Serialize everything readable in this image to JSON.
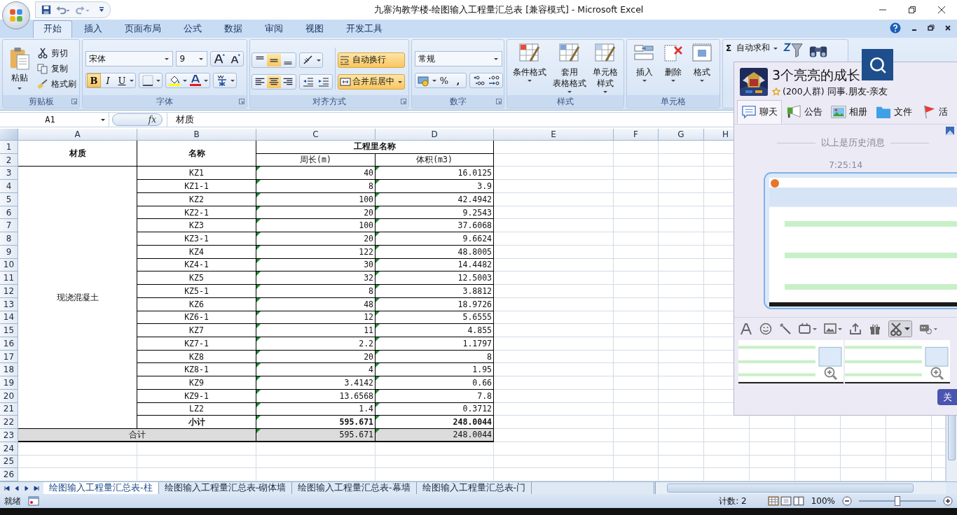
{
  "window": {
    "title": "九寨沟教学楼-绘图输入工程量汇总表  [兼容模式] - Microsoft Excel"
  },
  "ribbon_tabs": [
    {
      "label": "开始",
      "selected": true
    },
    {
      "label": "插入",
      "selected": false
    },
    {
      "label": "页面布局",
      "selected": false
    },
    {
      "label": "公式",
      "selected": false
    },
    {
      "label": "数据",
      "selected": false
    },
    {
      "label": "审阅",
      "selected": false
    },
    {
      "label": "视图",
      "selected": false
    },
    {
      "label": "开发工具",
      "selected": false
    }
  ],
  "ribbon": {
    "clipboard": {
      "label": "剪贴板",
      "paste": "粘贴",
      "cut": "剪切",
      "copy": "复制",
      "painter": "格式刷"
    },
    "font": {
      "label": "字体",
      "name": "宋体",
      "size": "9",
      "bold": {
        "text": "B",
        "selected": true
      },
      "italic": {
        "text": "I",
        "selected": false
      },
      "underline": {
        "text": "U",
        "selected": false
      }
    },
    "alignment": {
      "label": "对齐方式",
      "valign": [
        {
          "selected": false
        },
        {
          "selected": true
        },
        {
          "selected": false
        }
      ],
      "halign": [
        {
          "selected": false
        },
        {
          "selected": true
        },
        {
          "selected": false
        }
      ],
      "wrap": {
        "label": "自动换行",
        "selected": true
      },
      "merge": {
        "label": "合并后居中",
        "selected": true
      }
    },
    "number": {
      "label": "数字",
      "format": "常规",
      "percent": "%",
      "comma": ","
    },
    "styles": {
      "label": "样式",
      "items": [
        {
          "lines": [
            "条件格式"
          ]
        },
        {
          "lines": [
            "套用",
            "表格格式"
          ]
        },
        {
          "lines": [
            "单元格",
            "样式"
          ]
        }
      ]
    },
    "cells": {
      "label": "单元格",
      "items": [
        {
          "kind": "insert",
          "label": "插入"
        },
        {
          "kind": "delete",
          "label": "删除"
        },
        {
          "kind": "format",
          "label": "格式"
        }
      ]
    },
    "editing": {
      "sigma": "Σ",
      "autosum": "自动求和"
    }
  },
  "formula_bar": {
    "name_box": "A1",
    "fx": "fx",
    "content": "材质"
  },
  "sheet": {
    "columns": [
      "A",
      "B",
      "C",
      "D",
      "E",
      "F",
      "G",
      "H"
    ],
    "rows": [
      "1",
      "2",
      "3",
      "4",
      "5",
      "6",
      "7",
      "8",
      "9",
      "10",
      "11",
      "12",
      "13",
      "14",
      "15",
      "16",
      "17",
      "18",
      "19",
      "20",
      "21",
      "22",
      "23",
      "24",
      "25",
      "26"
    ]
  },
  "table": {
    "header": {
      "material": "材质",
      "name": "名称",
      "group": "工程里名称",
      "perimeter": "周长(m)",
      "volume": "体积(m3)"
    },
    "material": "现浇混凝土",
    "items": [
      {
        "name": "KZ1",
        "perimeter": "40",
        "volume": "16.0125",
        "flag": true
      },
      {
        "name": "KZ1-1",
        "perimeter": "8",
        "volume": "3.9",
        "flag": true
      },
      {
        "name": "KZ2",
        "perimeter": "100",
        "volume": "42.4942",
        "flag": true
      },
      {
        "name": "KZ2-1",
        "perimeter": "20",
        "volume": "9.2543",
        "flag": true
      },
      {
        "name": "KZ3",
        "perimeter": "100",
        "volume": "37.6068",
        "flag": true
      },
      {
        "name": "KZ3-1",
        "perimeter": "20",
        "volume": "9.6624",
        "flag": true
      },
      {
        "name": "KZ4",
        "perimeter": "122",
        "volume": "48.8005",
        "flag": true
      },
      {
        "name": "KZ4-1",
        "perimeter": "30",
        "volume": "14.4482",
        "flag": true
      },
      {
        "name": "KZ5",
        "perimeter": "32",
        "volume": "12.5003",
        "flag": true
      },
      {
        "name": "KZ5-1",
        "perimeter": "8",
        "volume": "3.8812",
        "flag": true
      },
      {
        "name": "KZ6",
        "perimeter": "48",
        "volume": "18.9726",
        "flag": true
      },
      {
        "name": "KZ6-1",
        "perimeter": "12",
        "volume": "5.6555",
        "flag": true
      },
      {
        "name": "KZ7",
        "perimeter": "11",
        "volume": "4.855",
        "flag": true
      },
      {
        "name": "KZ7-1",
        "perimeter": "2.2",
        "volume": "1.1797",
        "flag": true
      },
      {
        "name": "KZ8",
        "perimeter": "20",
        "volume": "8",
        "flag": true
      },
      {
        "name": "KZ8-1",
        "perimeter": "4",
        "volume": "1.95",
        "flag": true
      },
      {
        "name": "KZ9",
        "perimeter": "3.4142",
        "volume": "0.66",
        "flag": true
      },
      {
        "name": "KZ9-1",
        "perimeter": "13.6568",
        "volume": "7.8",
        "flag": true
      },
      {
        "name": "LZ2",
        "perimeter": "1.4",
        "volume": "0.3712",
        "flag": true
      }
    ],
    "subtotal": {
      "label": "小计",
      "perimeter": "595.671",
      "volume": "248.0044",
      "flag": true
    },
    "total": {
      "label": "合计",
      "perimeter": "595.671",
      "volume": "248.0044",
      "flag": true
    }
  },
  "sheet_tabs": [
    {
      "label": "绘图输入工程量汇总表-柱",
      "selected": true
    },
    {
      "label": "绘图输入工程量汇总表-砌体墙",
      "selected": false
    },
    {
      "label": "绘图输入工程量汇总表-幕墙",
      "selected": false
    },
    {
      "label": "绘图输入工程量汇总表-门",
      "selected": false
    }
  ],
  "status_bar": {
    "ready": "就绪",
    "count": "计数: 2",
    "zoom": "100%",
    "zoom_slider": {
      "level": 0.5
    }
  },
  "chat": {
    "title": "3个亮亮的成长",
    "subtitle": "(200人群) 同事.朋友-亲友",
    "tabs": [
      {
        "kind": "chat",
        "label": "聊天",
        "selected": true
      },
      {
        "kind": "notice",
        "label": "公告",
        "selected": false
      },
      {
        "kind": "album",
        "label": "相册",
        "selected": false
      },
      {
        "kind": "file",
        "label": "文件",
        "selected": false
      },
      {
        "kind": "event",
        "label": "活",
        "selected": false
      }
    ],
    "history": "以上是历史消息",
    "time": "7:25:14",
    "close_button": "关"
  }
}
